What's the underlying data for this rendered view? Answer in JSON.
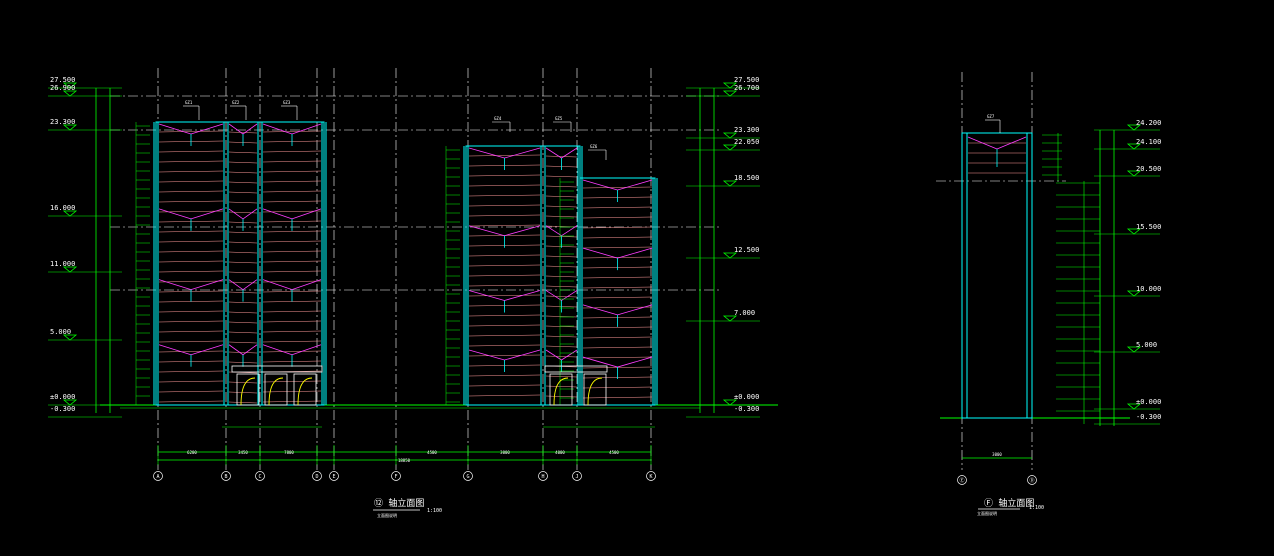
{
  "colors": {
    "background": "#000000",
    "grid": "#ffffff",
    "dimension": "#00ff00",
    "column": "#00ffff",
    "brace": "#ff3cff",
    "panel": "#ff9a9a",
    "door": "#ffff00",
    "text": "#ffffff"
  },
  "main_elevation": {
    "title": "⑫ 轴立面图",
    "scale": "1:100",
    "subtitle": "立面图说明",
    "left_levels": [
      "27.500",
      "26.900",
      "23.300",
      "16.000",
      "11.000",
      "5.000",
      "±0.000",
      "-0.300"
    ],
    "right_levels": [
      "27.500",
      "26.700",
      "23.300",
      "22.050",
      "18.500",
      "12.500",
      "7.000",
      "±0.000",
      "-0.300"
    ],
    "axes": [
      "A",
      "B",
      "C",
      "D",
      "E",
      "F",
      "G",
      "H",
      "J",
      "K"
    ],
    "total_dim": "18850",
    "span_dims": [
      "6200",
      "3450",
      "7800",
      "4500",
      "3000",
      "4000",
      "4500"
    ],
    "brace_tags_left": [
      "GZ1",
      "GZ2",
      "GZ3"
    ],
    "brace_tags_right": [
      "GZ4",
      "GZ5",
      "GZ6"
    ]
  },
  "side_elevation": {
    "title": "Ⓕ 轴立面图",
    "scale": "1:100",
    "subtitle": "立面图说明",
    "levels": [
      "24.200",
      "24.100",
      "20.500",
      "15.500",
      "10.000",
      "5.000",
      "±0.000",
      "-0.300"
    ],
    "axes": [
      "Ⓔ",
      "Ⓓ"
    ],
    "span_dim": "3000",
    "brace_tag": "GZ7"
  }
}
